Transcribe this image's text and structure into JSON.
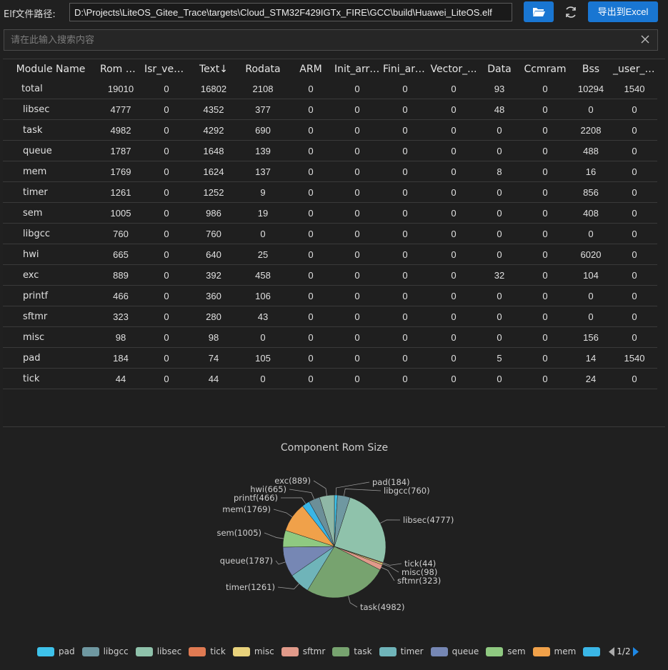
{
  "toolbar": {
    "path_label": "Elf文件路径:",
    "path_value": "D:\\Projects\\LiteOS_Gitee_Trace\\targets\\Cloud_STM32F429IGTx_FIRE\\GCC\\build\\Huawei_LiteOS.elf",
    "export_label": "导出到Excel"
  },
  "search": {
    "placeholder": "请在此输入搜索内容"
  },
  "table": {
    "columns": [
      "Module Name",
      "Rom Size",
      "Isr_vector",
      "Text",
      "Rodata",
      "ARM",
      "Init_array",
      "Fini_array",
      "Vector_...",
      "Data",
      "Ccmram",
      "Bss",
      "_user_h..."
    ],
    "sort_column": "Text",
    "sort_indicator": "↓",
    "rows": [
      [
        "total",
        "19010",
        "0",
        "16802",
        "2108",
        "0",
        "0",
        "0",
        "0",
        "93",
        "0",
        "10294",
        "1540"
      ],
      [
        "libsec",
        "4777",
        "0",
        "4352",
        "377",
        "0",
        "0",
        "0",
        "0",
        "48",
        "0",
        "0",
        "0"
      ],
      [
        "task",
        "4982",
        "0",
        "4292",
        "690",
        "0",
        "0",
        "0",
        "0",
        "0",
        "0",
        "2208",
        "0"
      ],
      [
        "queue",
        "1787",
        "0",
        "1648",
        "139",
        "0",
        "0",
        "0",
        "0",
        "0",
        "0",
        "488",
        "0"
      ],
      [
        "mem",
        "1769",
        "0",
        "1624",
        "137",
        "0",
        "0",
        "0",
        "0",
        "8",
        "0",
        "16",
        "0"
      ],
      [
        "timer",
        "1261",
        "0",
        "1252",
        "9",
        "0",
        "0",
        "0",
        "0",
        "0",
        "0",
        "856",
        "0"
      ],
      [
        "sem",
        "1005",
        "0",
        "986",
        "19",
        "0",
        "0",
        "0",
        "0",
        "0",
        "0",
        "408",
        "0"
      ],
      [
        "libgcc",
        "760",
        "0",
        "760",
        "0",
        "0",
        "0",
        "0",
        "0",
        "0",
        "0",
        "0",
        "0"
      ],
      [
        "hwi",
        "665",
        "0",
        "640",
        "25",
        "0",
        "0",
        "0",
        "0",
        "0",
        "0",
        "6020",
        "0"
      ],
      [
        "exc",
        "889",
        "0",
        "392",
        "458",
        "0",
        "0",
        "0",
        "0",
        "32",
        "0",
        "104",
        "0"
      ],
      [
        "printf",
        "466",
        "0",
        "360",
        "106",
        "0",
        "0",
        "0",
        "0",
        "0",
        "0",
        "0",
        "0"
      ],
      [
        "sftmr",
        "323",
        "0",
        "280",
        "43",
        "0",
        "0",
        "0",
        "0",
        "0",
        "0",
        "0",
        "0"
      ],
      [
        "misc",
        "98",
        "0",
        "98",
        "0",
        "0",
        "0",
        "0",
        "0",
        "0",
        "0",
        "156",
        "0"
      ],
      [
        "pad",
        "184",
        "0",
        "74",
        "105",
        "0",
        "0",
        "0",
        "0",
        "5",
        "0",
        "14",
        "1540"
      ],
      [
        "tick",
        "44",
        "0",
        "44",
        "0",
        "0",
        "0",
        "0",
        "0",
        "0",
        "0",
        "24",
        "0"
      ]
    ]
  },
  "chart_data": {
    "type": "pie",
    "title": "Component Rom Size",
    "slices": [
      {
        "name": "pad",
        "value": 184,
        "color": "#3ec2ea"
      },
      {
        "name": "libgcc",
        "value": 760,
        "color": "#6f98a1"
      },
      {
        "name": "libsec",
        "value": 4777,
        "color": "#8fc2ab"
      },
      {
        "name": "tick",
        "value": 44,
        "color": "#e07a52"
      },
      {
        "name": "misc",
        "value": 98,
        "color": "#e8d27c"
      },
      {
        "name": "sftmr",
        "value": 323,
        "color": "#e19a8a"
      },
      {
        "name": "task",
        "value": 4982,
        "color": "#77a36f"
      },
      {
        "name": "timer",
        "value": 1261,
        "color": "#6fb4b9"
      },
      {
        "name": "queue",
        "value": 1787,
        "color": "#7687b4"
      },
      {
        "name": "sem",
        "value": 1005,
        "color": "#8fc981"
      },
      {
        "name": "mem",
        "value": 1769,
        "color": "#f0a14a"
      },
      {
        "name": "printf",
        "value": 466,
        "color": "#3ab6e6"
      },
      {
        "name": "hwi",
        "value": 665,
        "color": "#6c8f98"
      },
      {
        "name": "exc",
        "value": 889,
        "color": "#8fb8a6"
      }
    ],
    "legend_visible": [
      "pad",
      "libgcc",
      "libsec",
      "tick",
      "misc",
      "sftmr",
      "task",
      "timer",
      "queue",
      "sem",
      "mem",
      ""
    ],
    "legend_page": "1/2",
    "legend_placement": "bottom"
  }
}
